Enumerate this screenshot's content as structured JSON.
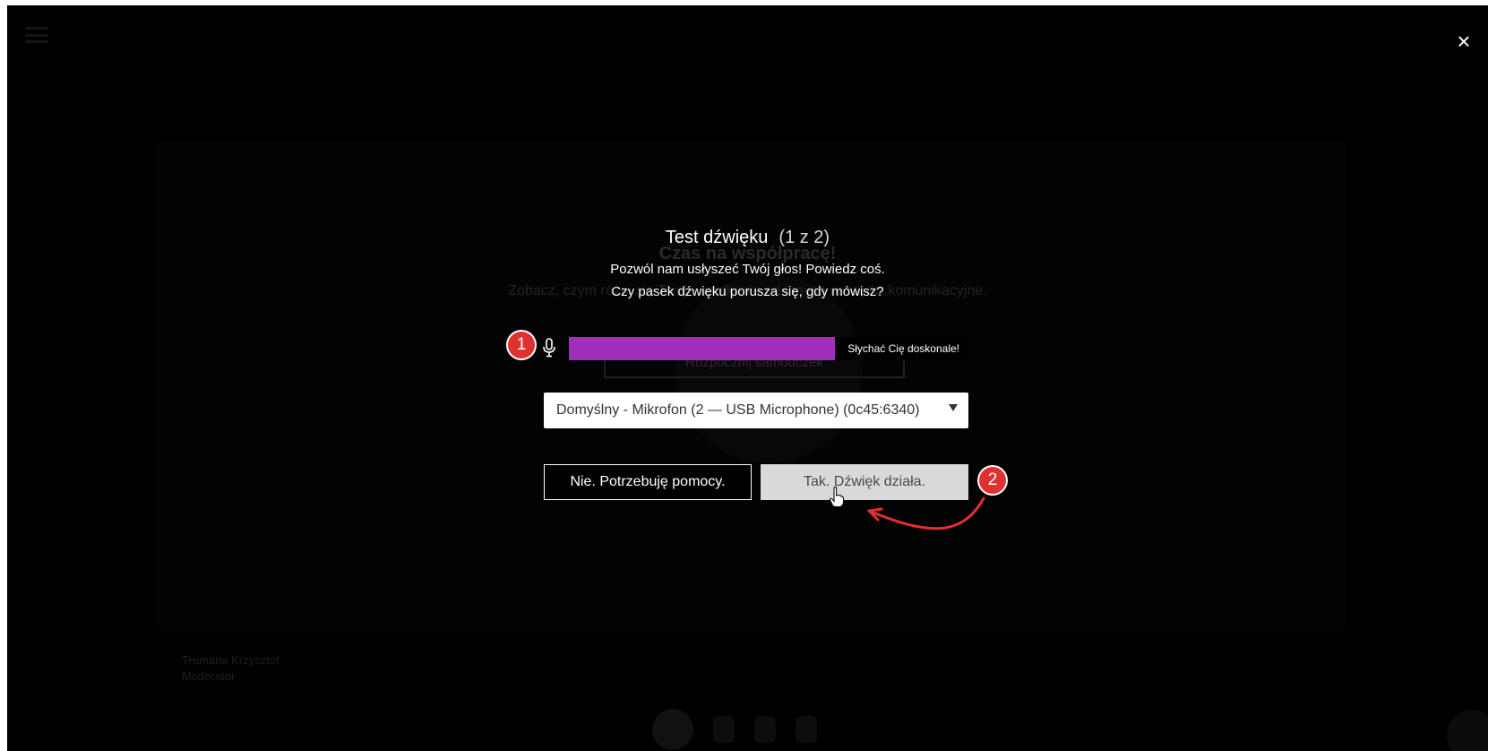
{
  "window": {
    "close_glyph": "×"
  },
  "background": {
    "heading": "Czas na współpracę!",
    "subtitle": "Zobacz, czym różni się Twoje spotkanie od innych narzędzi komunikacyjne.",
    "tutorial_button": "Rozpocznij samouczek",
    "user_name": "Tremaria Krzysztof",
    "user_role": "Moderator"
  },
  "modal": {
    "title": "Test dźwięku",
    "step": "(1 z 2)",
    "description_line1": "Pozwól nam usłyszeć Twój głos! Powiedz coś.",
    "description_line2": "Czy pasek dźwięku porusza się, gdy mówisz?",
    "mic_icon": "microphone-icon",
    "level": {
      "fraction": 0.67,
      "label": "Słychać Cię doskonale!",
      "color": "#a030b8"
    },
    "device": {
      "selected": "Domyślny - Mikrofon (2 — USB Microphone) (0c45:6340)"
    },
    "buttons": {
      "no_label": "Nie. Potrzebuję pomocy.",
      "yes_label": "Tak. Dźwięk działa."
    }
  },
  "annotations": {
    "badge1": "1",
    "badge2": "2",
    "color": "#e03131"
  }
}
